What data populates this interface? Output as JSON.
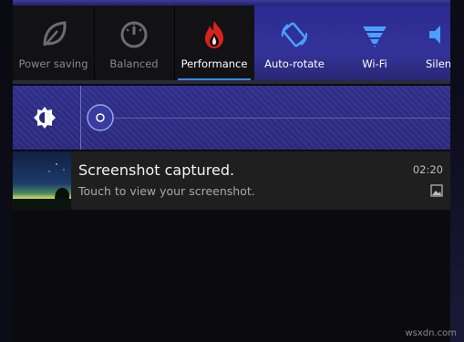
{
  "toggles": [
    {
      "label": "Power saving",
      "icon": "leaf-icon",
      "active": false
    },
    {
      "label": "Balanced",
      "icon": "gauge-icon",
      "active": false
    },
    {
      "label": "Performance",
      "icon": "flame-icon",
      "active": true
    },
    {
      "label": "Auto-rotate",
      "icon": "rotate-icon",
      "active": true
    },
    {
      "label": "Wi-Fi",
      "icon": "wifi-icon",
      "active": true
    },
    {
      "label": "Silen",
      "icon": "silent-icon",
      "active": false
    }
  ],
  "brightness": {
    "icon": "brightness-icon",
    "level": 0.0
  },
  "notification": {
    "title": "Screenshot captured.",
    "text": "Touch to view your screenshot.",
    "time": "02:20",
    "icon": "image-icon"
  },
  "watermark": "wsxdn.com",
  "colors": {
    "accent": "#2f8fe0",
    "highlight": "#2d2c93",
    "flame": "#d8231d"
  }
}
